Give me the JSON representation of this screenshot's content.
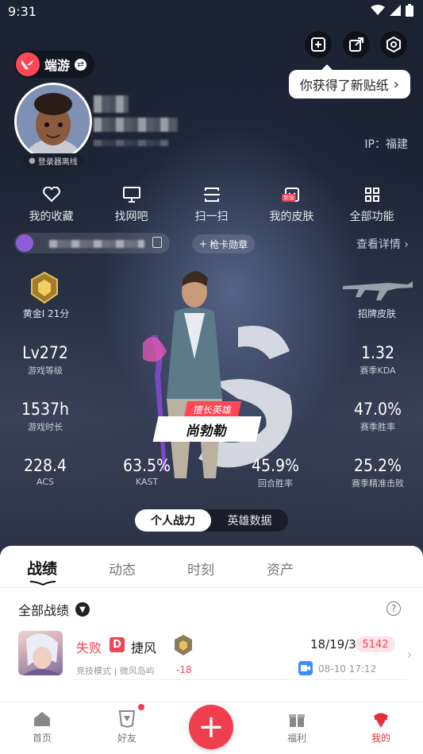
{
  "status_bar": {
    "time": "9:31"
  },
  "header": {
    "brand_name": "端游",
    "tooltip": "你获得了新贴纸"
  },
  "profile": {
    "status": "登录器离线",
    "ip": "IP：福建"
  },
  "quick_actions": [
    {
      "label": "我的收藏",
      "icon": "heart-icon"
    },
    {
      "label": "找网吧",
      "icon": "monitor-icon"
    },
    {
      "label": "扫一扫",
      "icon": "scan-icon"
    },
    {
      "label": "我的皮肤",
      "icon": "skin-icon",
      "badge": "新版"
    },
    {
      "label": "全部功能",
      "icon": "grid-icon"
    }
  ],
  "medal": {
    "add_label": "枪卡勋章",
    "detail_link": "查看详情"
  },
  "rank": {
    "label": "黄金I 21分"
  },
  "skin": {
    "label": "招牌皮肤"
  },
  "stats": {
    "level": {
      "value": "Lv272",
      "label": "游戏等级"
    },
    "kda": {
      "value": "1.32",
      "label": "赛季KDA"
    },
    "hours": {
      "value": "1537h",
      "label": "游戏时长"
    },
    "winrate": {
      "value": "47.0%",
      "label": "赛季胜率"
    },
    "acs": {
      "value": "228.4",
      "label": "ACS"
    },
    "kast": {
      "value": "63.5%",
      "label": "KAST"
    },
    "round_winrate": {
      "value": "45.9%",
      "label": "回合胜率"
    },
    "hs": {
      "value": "25.2%",
      "label": "赛季精准击败"
    }
  },
  "hero": {
    "tag": "擅长英雄",
    "name": "尚勃勒"
  },
  "toggle": {
    "active": "个人战力",
    "inactive": "英雄数据"
  },
  "tabs": [
    "战绩",
    "动态",
    "时刻",
    "资产"
  ],
  "filter": {
    "label": "全部战绩"
  },
  "match": {
    "result": "失败",
    "mode_badge": "D",
    "agent": "捷风",
    "mode_map": "竞技模式 | 微风岛屿",
    "rank_delta": "-18",
    "kda": "18/19/3",
    "score": "5142",
    "time": "08-10 17:12"
  },
  "nav": [
    {
      "label": "首页",
      "icon": "home-icon"
    },
    {
      "label": "好友",
      "icon": "friends-icon"
    },
    {
      "label": "福利",
      "icon": "gift-icon"
    },
    {
      "label": "我的",
      "icon": "profile-icon"
    }
  ],
  "colors": {
    "accent": "#ef3e4e",
    "bg_dark": "#1c2333"
  }
}
